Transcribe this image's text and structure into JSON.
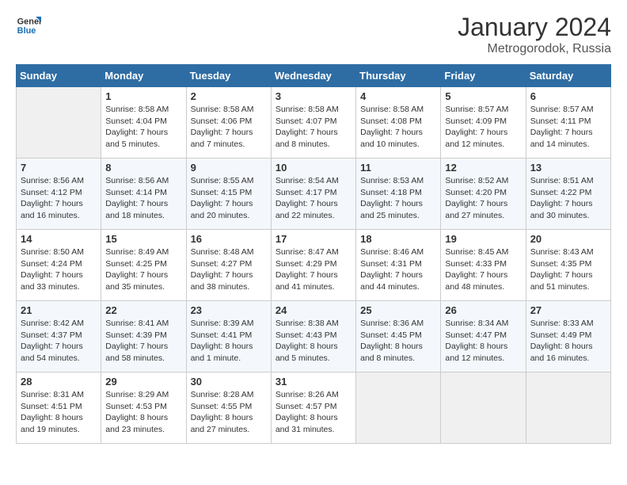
{
  "logo": {
    "line1": "General",
    "line2": "Blue"
  },
  "header": {
    "month": "January 2024",
    "location": "Metrogorodok, Russia"
  },
  "weekdays": [
    "Sunday",
    "Monday",
    "Tuesday",
    "Wednesday",
    "Thursday",
    "Friday",
    "Saturday"
  ],
  "weeks": [
    [
      {
        "day": "",
        "empty": true
      },
      {
        "day": "1",
        "sunrise": "Sunrise: 8:58 AM",
        "sunset": "Sunset: 4:04 PM",
        "daylight": "Daylight: 7 hours and 5 minutes."
      },
      {
        "day": "2",
        "sunrise": "Sunrise: 8:58 AM",
        "sunset": "Sunset: 4:06 PM",
        "daylight": "Daylight: 7 hours and 7 minutes."
      },
      {
        "day": "3",
        "sunrise": "Sunrise: 8:58 AM",
        "sunset": "Sunset: 4:07 PM",
        "daylight": "Daylight: 7 hours and 8 minutes."
      },
      {
        "day": "4",
        "sunrise": "Sunrise: 8:58 AM",
        "sunset": "Sunset: 4:08 PM",
        "daylight": "Daylight: 7 hours and 10 minutes."
      },
      {
        "day": "5",
        "sunrise": "Sunrise: 8:57 AM",
        "sunset": "Sunset: 4:09 PM",
        "daylight": "Daylight: 7 hours and 12 minutes."
      },
      {
        "day": "6",
        "sunrise": "Sunrise: 8:57 AM",
        "sunset": "Sunset: 4:11 PM",
        "daylight": "Daylight: 7 hours and 14 minutes."
      }
    ],
    [
      {
        "day": "7",
        "sunrise": "Sunrise: 8:56 AM",
        "sunset": "Sunset: 4:12 PM",
        "daylight": "Daylight: 7 hours and 16 minutes."
      },
      {
        "day": "8",
        "sunrise": "Sunrise: 8:56 AM",
        "sunset": "Sunset: 4:14 PM",
        "daylight": "Daylight: 7 hours and 18 minutes."
      },
      {
        "day": "9",
        "sunrise": "Sunrise: 8:55 AM",
        "sunset": "Sunset: 4:15 PM",
        "daylight": "Daylight: 7 hours and 20 minutes."
      },
      {
        "day": "10",
        "sunrise": "Sunrise: 8:54 AM",
        "sunset": "Sunset: 4:17 PM",
        "daylight": "Daylight: 7 hours and 22 minutes."
      },
      {
        "day": "11",
        "sunrise": "Sunrise: 8:53 AM",
        "sunset": "Sunset: 4:18 PM",
        "daylight": "Daylight: 7 hours and 25 minutes."
      },
      {
        "day": "12",
        "sunrise": "Sunrise: 8:52 AM",
        "sunset": "Sunset: 4:20 PM",
        "daylight": "Daylight: 7 hours and 27 minutes."
      },
      {
        "day": "13",
        "sunrise": "Sunrise: 8:51 AM",
        "sunset": "Sunset: 4:22 PM",
        "daylight": "Daylight: 7 hours and 30 minutes."
      }
    ],
    [
      {
        "day": "14",
        "sunrise": "Sunrise: 8:50 AM",
        "sunset": "Sunset: 4:24 PM",
        "daylight": "Daylight: 7 hours and 33 minutes."
      },
      {
        "day": "15",
        "sunrise": "Sunrise: 8:49 AM",
        "sunset": "Sunset: 4:25 PM",
        "daylight": "Daylight: 7 hours and 35 minutes."
      },
      {
        "day": "16",
        "sunrise": "Sunrise: 8:48 AM",
        "sunset": "Sunset: 4:27 PM",
        "daylight": "Daylight: 7 hours and 38 minutes."
      },
      {
        "day": "17",
        "sunrise": "Sunrise: 8:47 AM",
        "sunset": "Sunset: 4:29 PM",
        "daylight": "Daylight: 7 hours and 41 minutes."
      },
      {
        "day": "18",
        "sunrise": "Sunrise: 8:46 AM",
        "sunset": "Sunset: 4:31 PM",
        "daylight": "Daylight: 7 hours and 44 minutes."
      },
      {
        "day": "19",
        "sunrise": "Sunrise: 8:45 AM",
        "sunset": "Sunset: 4:33 PM",
        "daylight": "Daylight: 7 hours and 48 minutes."
      },
      {
        "day": "20",
        "sunrise": "Sunrise: 8:43 AM",
        "sunset": "Sunset: 4:35 PM",
        "daylight": "Daylight: 7 hours and 51 minutes."
      }
    ],
    [
      {
        "day": "21",
        "sunrise": "Sunrise: 8:42 AM",
        "sunset": "Sunset: 4:37 PM",
        "daylight": "Daylight: 7 hours and 54 minutes."
      },
      {
        "day": "22",
        "sunrise": "Sunrise: 8:41 AM",
        "sunset": "Sunset: 4:39 PM",
        "daylight": "Daylight: 7 hours and 58 minutes."
      },
      {
        "day": "23",
        "sunrise": "Sunrise: 8:39 AM",
        "sunset": "Sunset: 4:41 PM",
        "daylight": "Daylight: 8 hours and 1 minute."
      },
      {
        "day": "24",
        "sunrise": "Sunrise: 8:38 AM",
        "sunset": "Sunset: 4:43 PM",
        "daylight": "Daylight: 8 hours and 5 minutes."
      },
      {
        "day": "25",
        "sunrise": "Sunrise: 8:36 AM",
        "sunset": "Sunset: 4:45 PM",
        "daylight": "Daylight: 8 hours and 8 minutes."
      },
      {
        "day": "26",
        "sunrise": "Sunrise: 8:34 AM",
        "sunset": "Sunset: 4:47 PM",
        "daylight": "Daylight: 8 hours and 12 minutes."
      },
      {
        "day": "27",
        "sunrise": "Sunrise: 8:33 AM",
        "sunset": "Sunset: 4:49 PM",
        "daylight": "Daylight: 8 hours and 16 minutes."
      }
    ],
    [
      {
        "day": "28",
        "sunrise": "Sunrise: 8:31 AM",
        "sunset": "Sunset: 4:51 PM",
        "daylight": "Daylight: 8 hours and 19 minutes."
      },
      {
        "day": "29",
        "sunrise": "Sunrise: 8:29 AM",
        "sunset": "Sunset: 4:53 PM",
        "daylight": "Daylight: 8 hours and 23 minutes."
      },
      {
        "day": "30",
        "sunrise": "Sunrise: 8:28 AM",
        "sunset": "Sunset: 4:55 PM",
        "daylight": "Daylight: 8 hours and 27 minutes."
      },
      {
        "day": "31",
        "sunrise": "Sunrise: 8:26 AM",
        "sunset": "Sunset: 4:57 PM",
        "daylight": "Daylight: 8 hours and 31 minutes."
      },
      {
        "day": "",
        "empty": true
      },
      {
        "day": "",
        "empty": true
      },
      {
        "day": "",
        "empty": true
      }
    ]
  ]
}
